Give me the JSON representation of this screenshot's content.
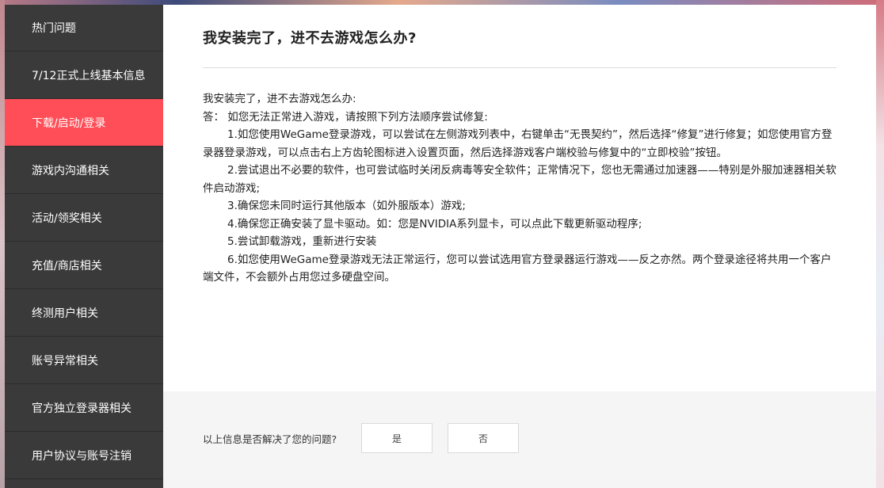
{
  "sidebar": {
    "items": [
      {
        "label": "热门问题"
      },
      {
        "label": "7/12正式上线基本信息"
      },
      {
        "label": "下载/启动/登录",
        "active": true
      },
      {
        "label": "游戏内沟通相关"
      },
      {
        "label": "活动/领奖相关"
      },
      {
        "label": "充值/商店相关"
      },
      {
        "label": "终测用户相关"
      },
      {
        "label": "账号异常相关"
      },
      {
        "label": "官方独立登录器相关"
      },
      {
        "label": "用户协议与账号注销"
      }
    ]
  },
  "main": {
    "title": "我安装完了，进不去游戏怎么办?",
    "article": {
      "lines": [
        "我安装完了，进不去游戏怎么办:",
        "答：  如您无法正常进入游戏，请按照下列方法顺序尝试修复:",
        "1.如您使用WeGame登录游戏，可以尝试在左侧游戏列表中，右键单击“无畏契约”，然后选择“修复”进行修复；如您使用官方登录器登录游戏，可以点击右上方齿轮图标进入设置页面，然后选择游戏客户端校验与修复中的“立即校验”按钮。",
        "2.尝试退出不必要的软件，也可尝试临时关闭反病毒等安全软件；正常情况下，您也无需通过加速器——特别是外服加速器相关软件启动游戏;",
        "3.确保您未同时运行其他版本（如外服版本）游戏;",
        "4.确保您正确安装了显卡驱动。如：您是NVIDIA系列显卡，可以点此下载更新驱动程序;",
        "5.尝试卸载游戏，重新进行安装",
        "6.如您使用WeGame登录游戏无法正常运行，您可以尝试选用官方登录器运行游戏——反之亦然。两个登录途径将共用一个客户端文件，不会额外占用您过多硬盘空间。"
      ]
    }
  },
  "feedback": {
    "question": "以上信息是否解决了您的问题?",
    "yes_label": "是",
    "no_label": "否"
  },
  "colors": {
    "sidebar_bg": "#3a3a3a",
    "active_item": "#ff4e57",
    "content_bg": "#ffffff",
    "feedback_bg": "#f5f5f5"
  }
}
